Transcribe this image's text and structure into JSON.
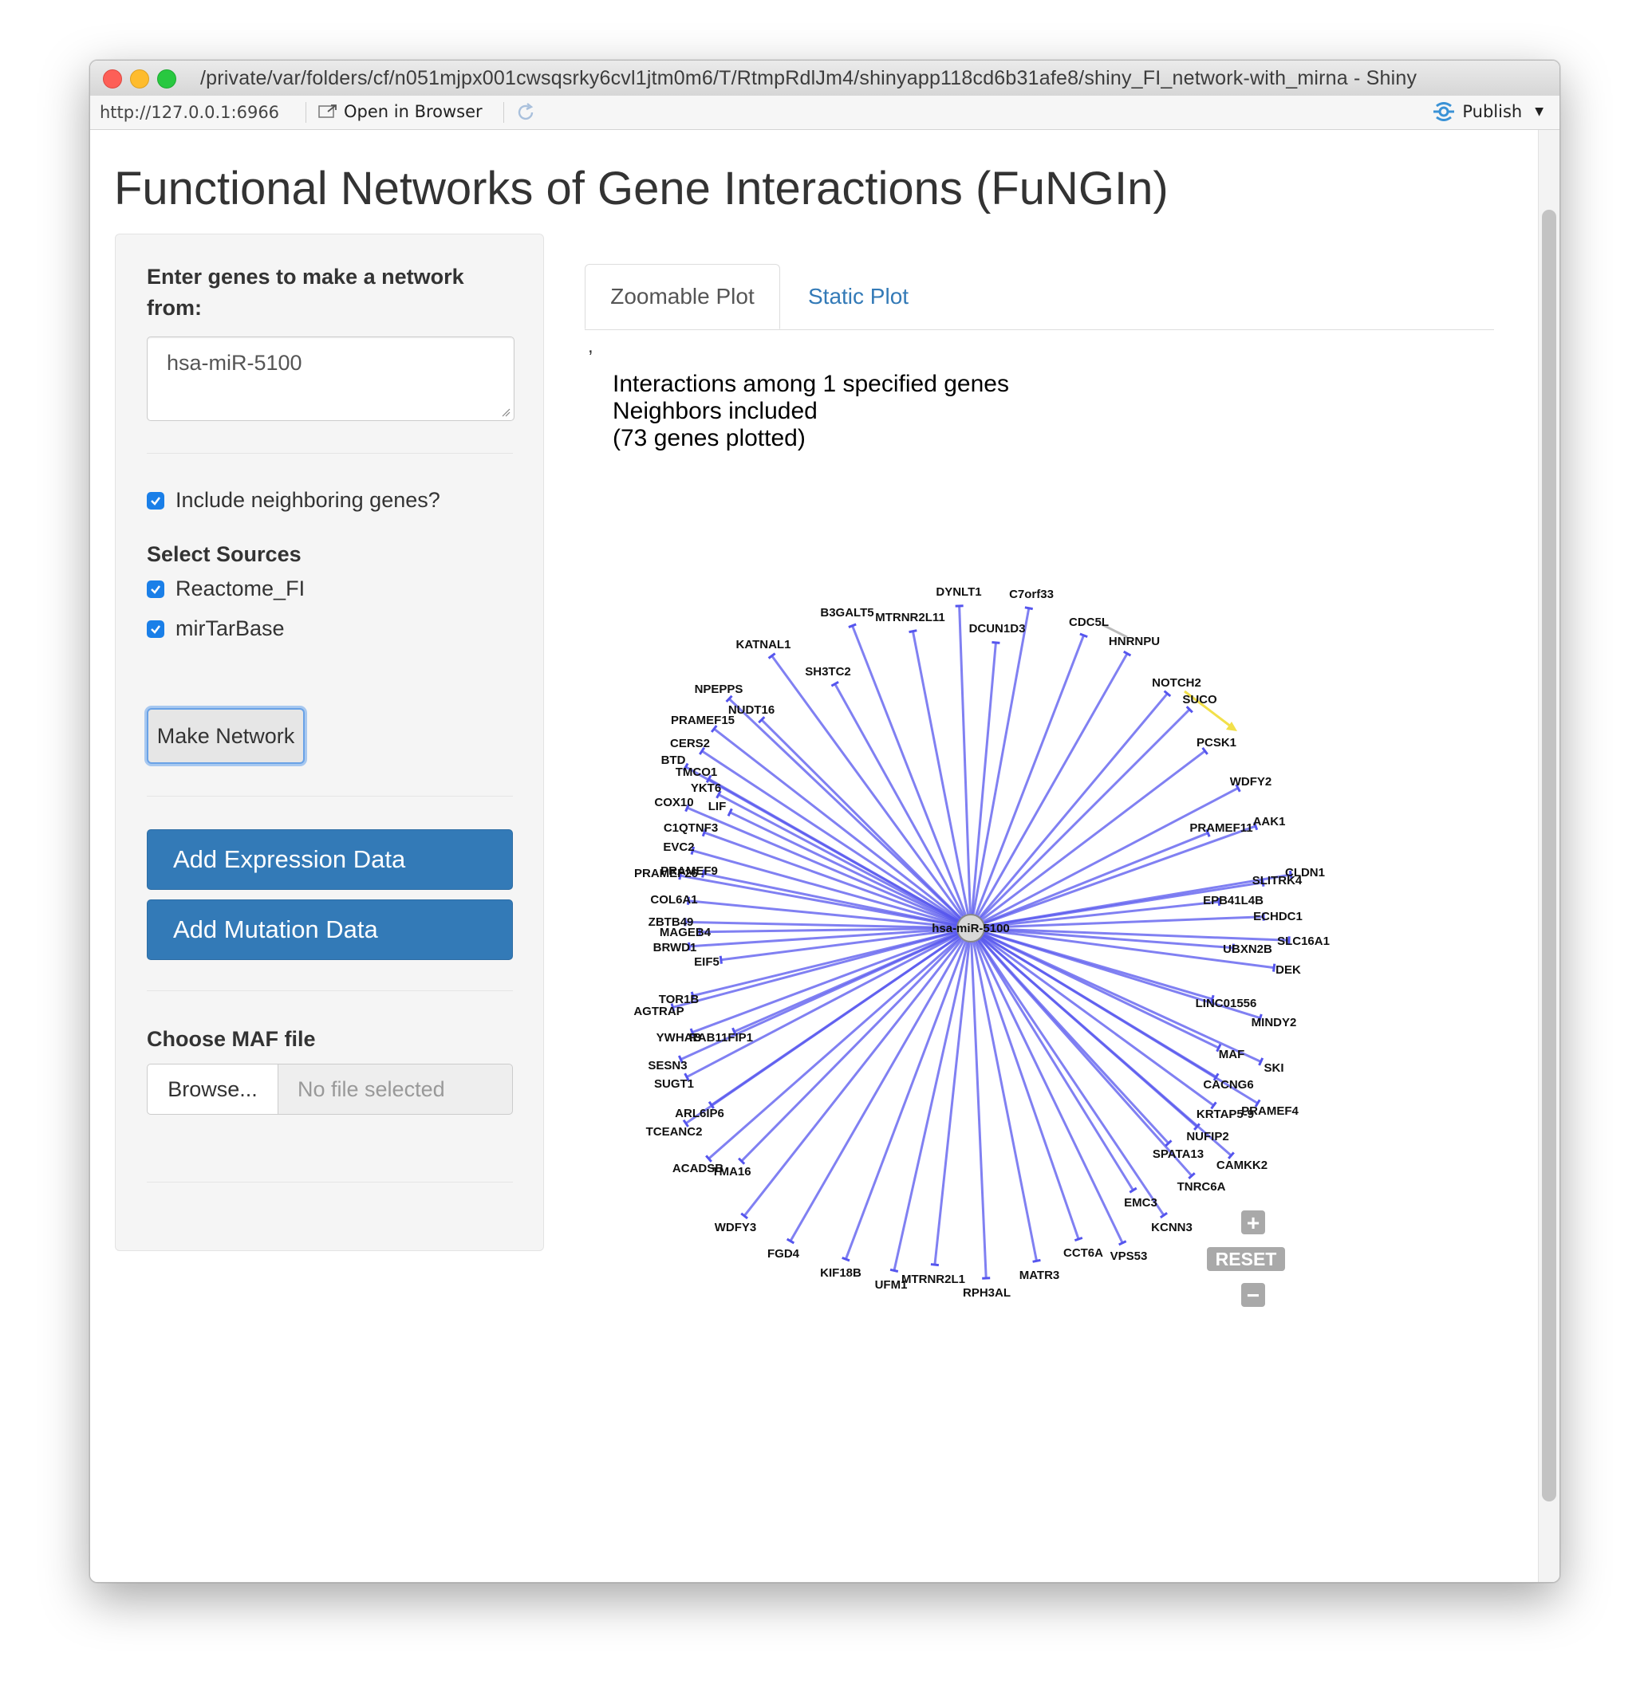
{
  "window": {
    "title": "/private/var/folders/cf/n051mjpx001cwsqsrky6cvl1jtm0m6/T/RtmpRdlJm4/shinyapp118cd6b31afe8/shiny_FI_network-with_mirna - Shiny"
  },
  "toolbar": {
    "url": "http://127.0.0.1:6966",
    "open_in_browser": "Open in Browser",
    "publish": "Publish"
  },
  "app": {
    "title": "Functional Networks of Gene Interactions (FuNGIn)"
  },
  "sidebar": {
    "genes_label": "Enter genes to make a network from:",
    "genes_value": "hsa-miR-5100",
    "include_neighbors_label": "Include neighboring genes?",
    "include_neighbors_checked": true,
    "sources_label": "Select Sources",
    "sources": [
      {
        "label": "Reactome_FI",
        "checked": true
      },
      {
        "label": "mirTarBase",
        "checked": true
      }
    ],
    "make_network": "Make Network",
    "add_expression": "Add Expression Data",
    "add_mutation": "Add Mutation Data",
    "maf_label": "Choose MAF file",
    "browse": "Browse...",
    "no_file": "No file selected"
  },
  "tabs": [
    {
      "label": "Zoomable Plot",
      "active": true
    },
    {
      "label": "Static Plot",
      "active": false
    }
  ],
  "plot": {
    "stray_text": ",",
    "title_lines": [
      "Interactions among 1 specified genes",
      "Neighbors included",
      "(73 genes plotted)"
    ],
    "center_node": "hsa-miR-5100",
    "edge_color": "#5555ee",
    "highlight_edge_color": "#f2e04a",
    "nodes": [
      "DYNLT1",
      "C7orf33",
      "B3GALT5",
      "MTRNR2L11",
      "DCUN1D3",
      "CDC5L",
      "HNRNPU",
      "KATNAL1",
      "SH3TC2",
      "NOTCH2",
      "SUCO",
      "NPEPPS",
      "NUDT16",
      "PRAMEF15",
      "PCSK1",
      "CERS2",
      "BTD",
      "TMCO1",
      "WDFY2",
      "YKT6",
      "COX10",
      "LIF",
      "C1QTNF3",
      "PRAMEF11",
      "AAK1",
      "EVC2",
      "PRAMEF9",
      "PRAMEF26",
      "CLDN1",
      "SLITRK4",
      "COL6A1",
      "EPB41L4B",
      "ECHDC1",
      "ZBTB49",
      "MAGEB4",
      "SLC16A1",
      "BRWD1",
      "UBXN2B",
      "EIF5",
      "DEK",
      "TOR1B",
      "AGTRAP",
      "LINC01556",
      "MINDY2",
      "YWHAB",
      "RAB11FIP1",
      "MAF",
      "SESN3",
      "SKI",
      "SUGT1",
      "CACNG6",
      "ARL6IP6",
      "PRAMEF4",
      "KRTAP5-9",
      "TCEANC2",
      "NUFIP2",
      "SPATA13",
      "CAMKK2",
      "ACADSB",
      "TMA16",
      "TNRC6A",
      "EMC3",
      "WDFY3",
      "KCNN3",
      "FGD4",
      "CCT6A",
      "VPS53",
      "KIF18B",
      "MATR3",
      "UFM1",
      "MTRNR2L1",
      "RPH3AL"
    ],
    "controls": {
      "zoom_in": "+",
      "reset": "RESET",
      "zoom_out": "−"
    }
  }
}
